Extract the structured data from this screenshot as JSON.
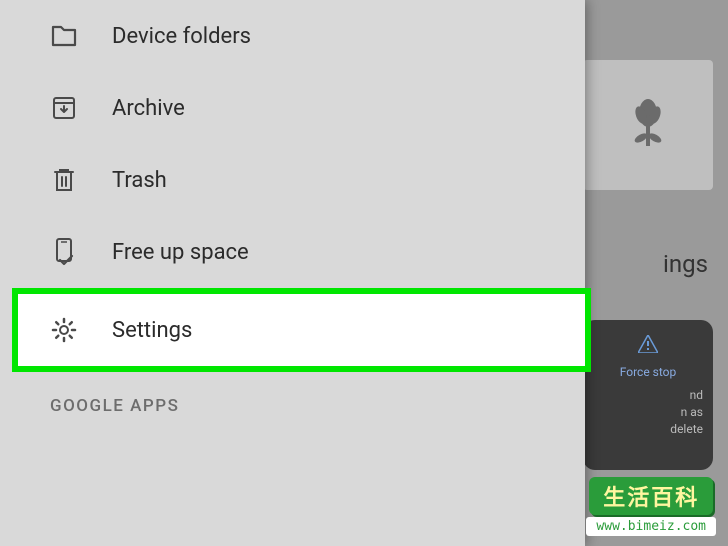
{
  "drawer": {
    "items": [
      {
        "label": "Device folders",
        "icon": "folder-icon"
      },
      {
        "label": "Archive",
        "icon": "archive-icon"
      },
      {
        "label": "Trash",
        "icon": "trash-icon"
      },
      {
        "label": "Free up space",
        "icon": "free-up-space-icon"
      },
      {
        "label": "Settings",
        "icon": "gear-icon"
      }
    ],
    "section_header": "GOOGLE APPS"
  },
  "background": {
    "partial_heading": "ings",
    "dialog": {
      "title": "Force stop",
      "body_fragment_1": "nd",
      "body_fragment_2": "n as",
      "body_fragment_3": "delete"
    }
  },
  "watermark": {
    "text": "生活百科",
    "url": "www.bimeiz.com"
  }
}
